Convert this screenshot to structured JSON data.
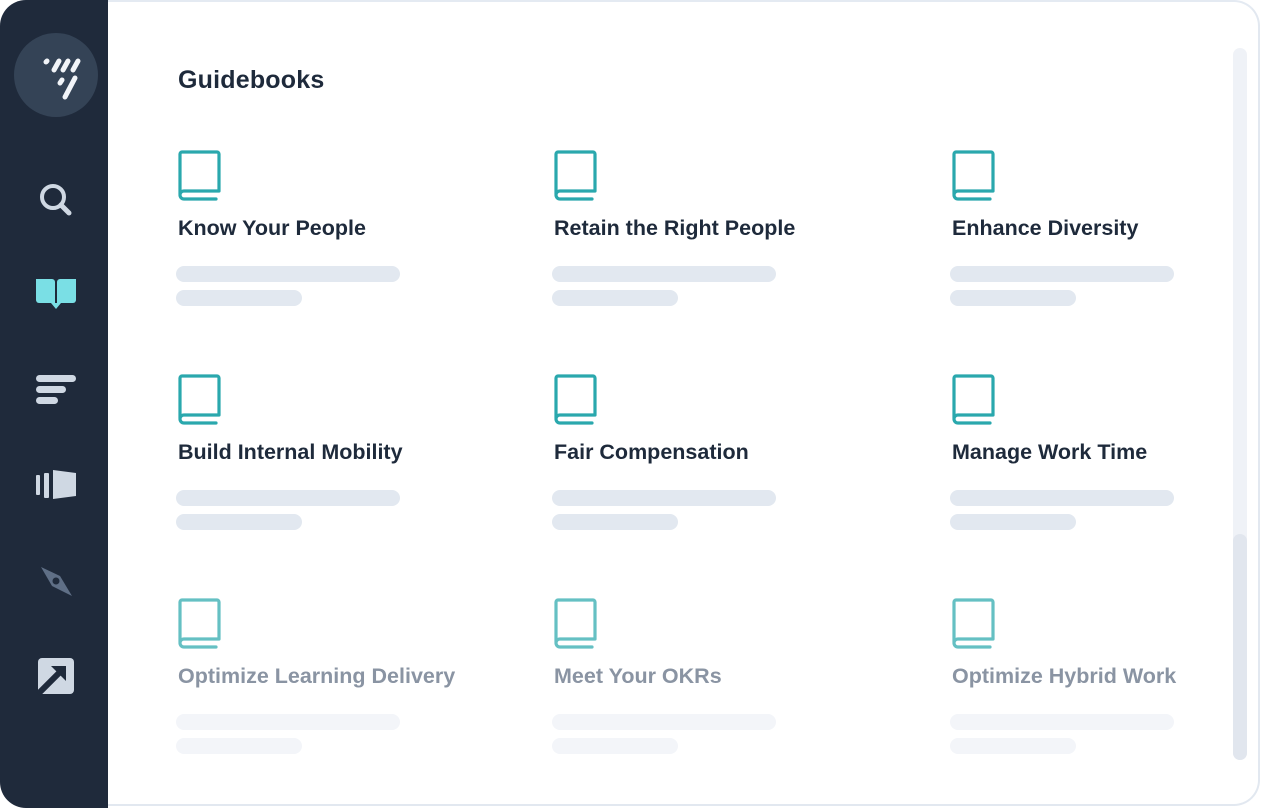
{
  "app": {
    "brand_icon": "logo-slashes-icon"
  },
  "sidebar": {
    "items": [
      {
        "name": "search",
        "icon": "search-icon",
        "active": false
      },
      {
        "name": "guidebooks",
        "icon": "open-book-icon",
        "active": true
      },
      {
        "name": "reports",
        "icon": "bars-icon",
        "active": false
      },
      {
        "name": "presentations",
        "icon": "slides-icon",
        "active": false
      },
      {
        "name": "explore",
        "icon": "compass-icon",
        "active": false
      },
      {
        "name": "external",
        "icon": "external-link-icon",
        "active": false
      }
    ]
  },
  "colors": {
    "sidebar_bg": "#1f2a3b",
    "accent_teal": "#2aa8ad",
    "active_icon": "#7adfe5",
    "icon_default": "#cfd8e3",
    "icon_muted": "#5f6f86",
    "title_text": "#1e2a3b",
    "faded_text": "#8a94a3",
    "skeleton": "#e2e8f0"
  },
  "main": {
    "heading": "Guidebooks",
    "guidebooks": [
      {
        "title": "Know Your People",
        "icon": "book-icon",
        "faded": false
      },
      {
        "title": "Retain the Right People",
        "icon": "book-icon",
        "faded": false
      },
      {
        "title": "Enhance Diversity",
        "icon": "book-icon",
        "faded": false
      },
      {
        "title": "Build Internal Mobility",
        "icon": "book-icon",
        "faded": false
      },
      {
        "title": "Fair Compensation",
        "icon": "book-icon",
        "faded": false
      },
      {
        "title": "Manage Work Time",
        "icon": "book-icon",
        "faded": false
      },
      {
        "title": "Optimize Learning Delivery",
        "icon": "book-icon",
        "faded": true
      },
      {
        "title": "Meet Your OKRs",
        "icon": "book-icon",
        "faded": true
      },
      {
        "title": "Optimize Hybrid Work",
        "icon": "book-icon",
        "faded": true
      }
    ]
  }
}
